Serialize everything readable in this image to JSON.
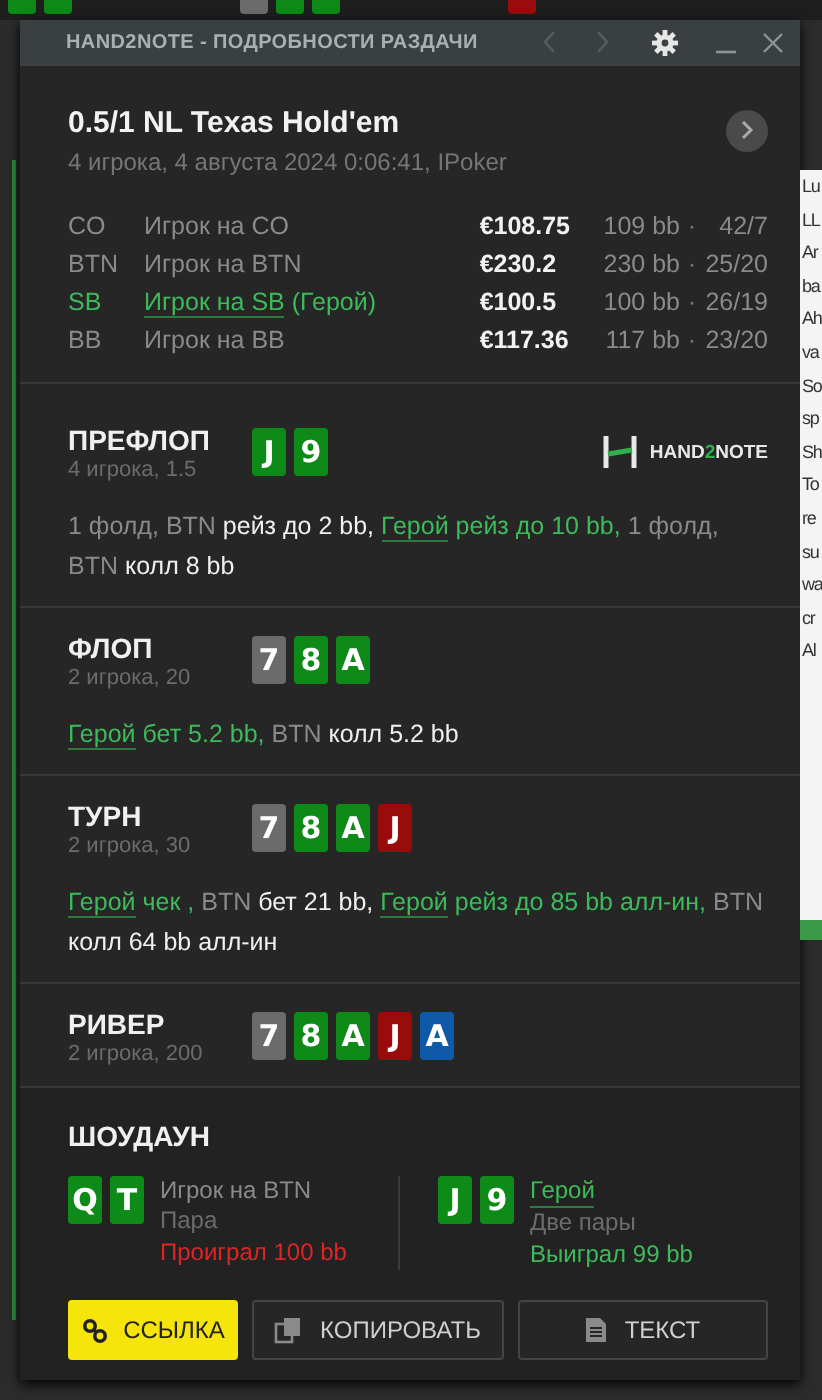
{
  "background": {
    "top_cards": [
      {
        "color": "#0d8a17"
      },
      {
        "color": "#0d8a17"
      },
      {
        "color": "#6b6b6b"
      },
      {
        "color": "#0d8a17"
      },
      {
        "color": "#0d8a17"
      },
      {
        "color": "#9a0c0c"
      }
    ],
    "side_list": [
      "Lu",
      "LL",
      "Ar",
      "ba",
      "Ah",
      "va",
      "So",
      "sp",
      "Sh",
      "To",
      "re",
      "su",
      "wa",
      "cr",
      "Al"
    ]
  },
  "window": {
    "title": "HAND2NOTE - ПОДРОБНОСТИ РАЗДАЧИ",
    "back_disabled": true,
    "forward_disabled": true
  },
  "header": {
    "title": "0.5/1 NL Texas Hold'em",
    "subtitle": "4 игрока, 4 августа 2024 0:06:41, IPoker"
  },
  "players": [
    {
      "position": "CO",
      "name": "Игрок на CO",
      "hero": false,
      "stack": "€108.75",
      "bb": "109 bb",
      "separator": "·",
      "stats": "42/7"
    },
    {
      "position": "BTN",
      "name": "Игрок на BTN",
      "hero": false,
      "stack": "€230.2",
      "bb": "230 bb",
      "separator": "·",
      "stats": "25/20"
    },
    {
      "position": "SB",
      "name": "Игрок на SB",
      "hero_tag": "(Герой)",
      "hero": true,
      "stack": "€100.5",
      "bb": "100 bb",
      "separator": "·",
      "stats": "26/19"
    },
    {
      "position": "BB",
      "name": "Игрок на BB",
      "hero": false,
      "stack": "€117.36",
      "bb": "117 bb",
      "separator": "·",
      "stats": "23/20"
    }
  ],
  "streets": [
    {
      "name": "ПРЕФЛОП",
      "info": "4 игрока, 1.5",
      "logo": {
        "parts": [
          "HAND",
          "2",
          "NOTE"
        ]
      },
      "cards": [
        {
          "rank": "J",
          "color": "#0d8a17"
        },
        {
          "rank": "9",
          "color": "#0d8a17"
        }
      ],
      "actions": [
        {
          "kind": "plain",
          "text": "1 фолд,"
        },
        {
          "kind": "plain",
          "text": "BTN"
        },
        {
          "kind": "action",
          "text": "рейз до 2 bb,"
        },
        {
          "kind": "hero",
          "text": "Герой"
        },
        {
          "kind": "hero_action",
          "text": "рейз до 10 bb,"
        },
        {
          "kind": "plain",
          "text": "1 фолд,"
        },
        {
          "kind": "plain",
          "text": "BTN"
        },
        {
          "kind": "action",
          "text": "колл 8 bb"
        }
      ]
    },
    {
      "name": "ФЛОП",
      "info": "2 игрока, 20",
      "cards": [
        {
          "rank": "7",
          "color": "#6b6b6b"
        },
        {
          "rank": "8",
          "color": "#0d8a17"
        },
        {
          "rank": "A",
          "color": "#0d8a17"
        }
      ],
      "actions": [
        {
          "kind": "hero",
          "text": "Герой"
        },
        {
          "kind": "hero_action",
          "text": "бет 5.2 bb,"
        },
        {
          "kind": "plain",
          "text": "BTN"
        },
        {
          "kind": "action",
          "text": "колл 5.2 bb"
        }
      ]
    },
    {
      "name": "ТУРН",
      "info": "2 игрока, 30",
      "cards": [
        {
          "rank": "7",
          "color": "#6b6b6b"
        },
        {
          "rank": "8",
          "color": "#0d8a17"
        },
        {
          "rank": "A",
          "color": "#0d8a17"
        },
        {
          "rank": "J",
          "color": "#9a0c0c"
        }
      ],
      "actions": [
        {
          "kind": "hero",
          "text": "Герой"
        },
        {
          "kind": "hero_action",
          "text": "чек ,"
        },
        {
          "kind": "plain",
          "text": "BTN"
        },
        {
          "kind": "action",
          "text": "бет 21 bb,"
        },
        {
          "kind": "hero",
          "text": "Герой"
        },
        {
          "kind": "hero_action",
          "text": "рейз до 85 bb алл-ин,"
        },
        {
          "kind": "plain",
          "text": "BTN"
        },
        {
          "kind": "action",
          "text": "колл 64 bb алл-ин"
        }
      ]
    },
    {
      "name": "РИВЕР",
      "info": "2 игрока, 200",
      "cards": [
        {
          "rank": "7",
          "color": "#6b6b6b"
        },
        {
          "rank": "8",
          "color": "#0d8a17"
        },
        {
          "rank": "A",
          "color": "#0d8a17"
        },
        {
          "rank": "J",
          "color": "#9a0c0c"
        },
        {
          "rank": "A",
          "color": "#0e5aa8"
        }
      ]
    }
  ],
  "showdown": {
    "title": "ШОУДАУН",
    "players": [
      {
        "cards": [
          {
            "rank": "Q",
            "color": "#0d8a17"
          },
          {
            "rank": "T",
            "color": "#0d8a17"
          }
        ],
        "name": "Игрок на BTN",
        "hero": false,
        "hand": "Пара",
        "result": "Проиграл 100 bb",
        "won": false
      },
      {
        "cards": [
          {
            "rank": "J",
            "color": "#0d8a17"
          },
          {
            "rank": "9",
            "color": "#0d8a17"
          }
        ],
        "name": "Герой",
        "hero": true,
        "hand": "Две пары",
        "result": "Выиграл 99 bb",
        "won": true
      }
    ]
  },
  "buttons": [
    {
      "kind": "link",
      "label": "ССЫЛКА",
      "highlighted": true
    },
    {
      "kind": "copy",
      "label": "КОПИРОВАТЬ",
      "highlighted": false
    },
    {
      "kind": "text",
      "label": "ТЕКСТ",
      "highlighted": false
    }
  ]
}
